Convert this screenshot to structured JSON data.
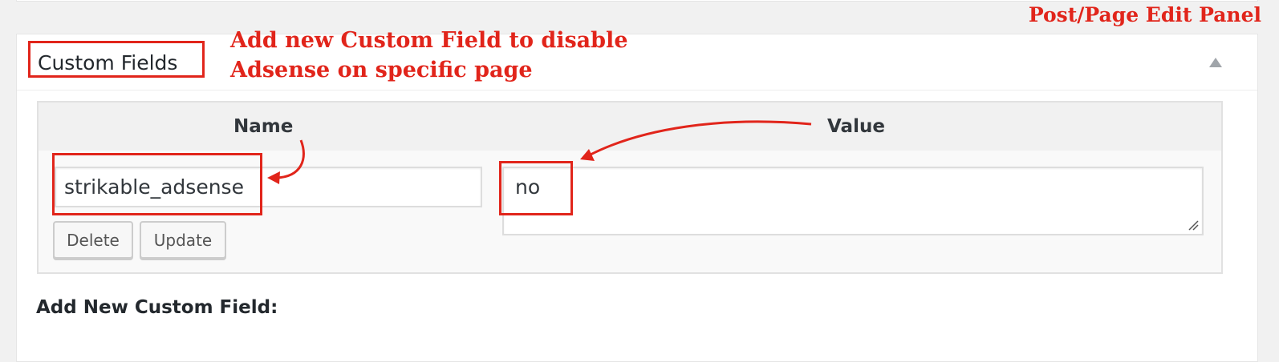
{
  "annotations": {
    "caption": "Post/Page Edit Panel",
    "note_line1": "Add new Custom Field to disable",
    "note_line2": "Adsense on specific page",
    "accent_color": "#e1251b"
  },
  "metabox": {
    "title": "Custom Fields",
    "toggle_icon": "triangle-up-icon"
  },
  "meta_table": {
    "headers": {
      "name": "Name",
      "value": "Value"
    },
    "row": {
      "key": "strikable_adsense",
      "value": "no",
      "delete_label": "Delete",
      "update_label": "Update"
    }
  },
  "add_new": {
    "title": "Add New Custom Field:"
  }
}
